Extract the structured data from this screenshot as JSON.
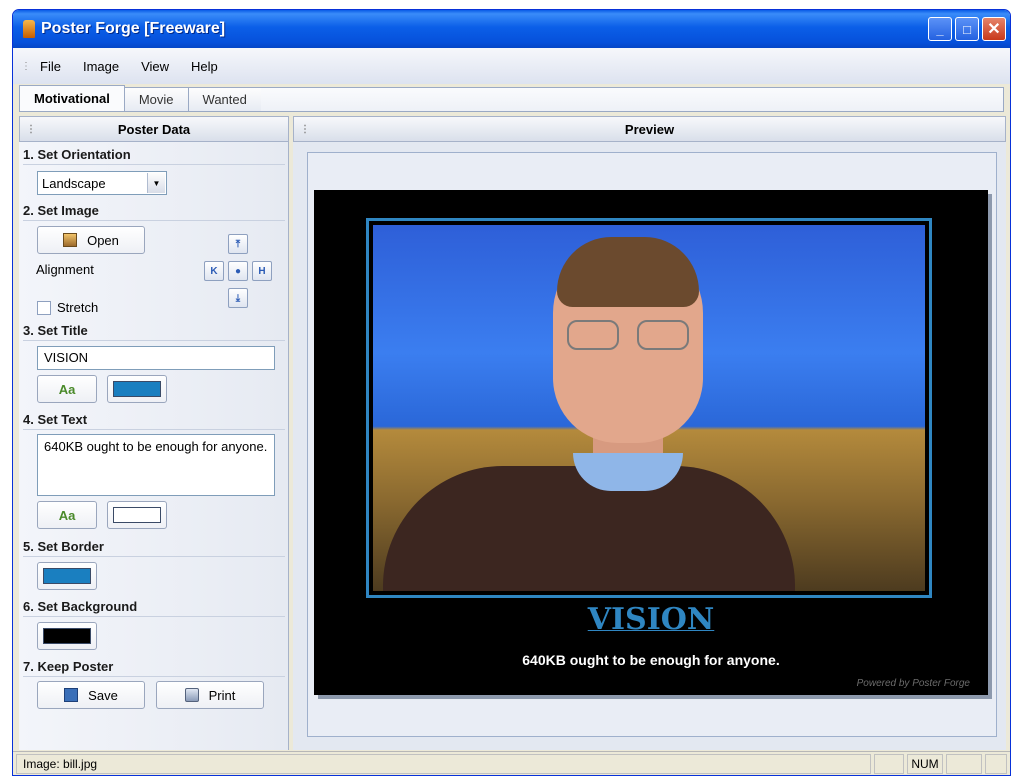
{
  "window": {
    "title": "Poster Forge [Freeware]",
    "minimize": "_",
    "maximize": "□",
    "close": "✕"
  },
  "menu": [
    {
      "label": "File"
    },
    {
      "label": "Image"
    },
    {
      "label": "View"
    },
    {
      "label": "Help"
    }
  ],
  "tabs": [
    {
      "label": "Motivational",
      "active": true
    },
    {
      "label": "Movie",
      "active": false
    },
    {
      "label": "Wanted",
      "active": false
    }
  ],
  "left_panel": {
    "header": "Poster Data",
    "orientation": {
      "label": "1. Set Orientation",
      "value": "Landscape"
    },
    "image": {
      "label": "2. Set Image",
      "open_button": "Open",
      "alignment_label": "Alignment",
      "stretch_label": "Stretch",
      "stretch_checked": false,
      "align_up": "⤒",
      "align_left": "K",
      "align_center": "●",
      "align_right": "H",
      "align_down": "⤓"
    },
    "title": {
      "label": "3. Set Title",
      "value": "VISION",
      "font_button": "Aa",
      "color": "#1a7fc0"
    },
    "text": {
      "label": "4. Set Text",
      "value": "640KB ought to be enough for anyone.",
      "font_button": "Aa",
      "color": "#ffffff"
    },
    "border": {
      "label": "5. Set Border",
      "color": "#1a7fc0"
    },
    "background": {
      "label": "6. Set Background",
      "color": "#000000"
    },
    "keep": {
      "label": "7. Keep Poster",
      "save_button": "Save",
      "print_button": "Print"
    }
  },
  "preview": {
    "header": "Preview",
    "poster_title": "VISION",
    "poster_text": "640KB ought to be enough for anyone.",
    "credit": "Powered by Poster Forge"
  },
  "status": {
    "image": "Image: bill.jpg",
    "num": "NUM"
  }
}
